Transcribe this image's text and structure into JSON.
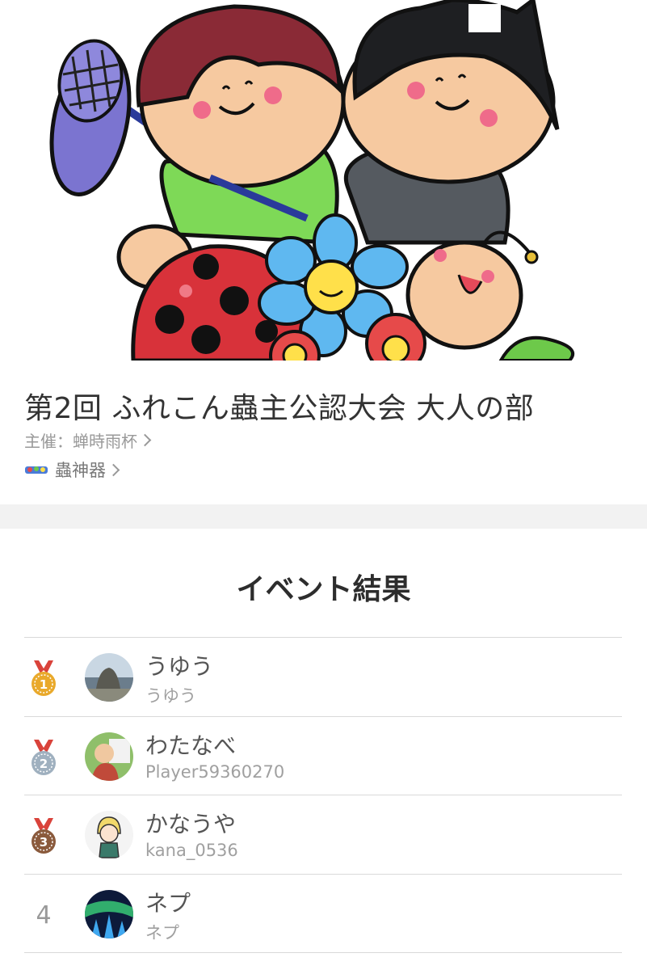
{
  "event": {
    "title": "第2回 ふれこん蟲主公認大会 大人の部",
    "organizer_label": "主催：蝉時雨杯",
    "game_label": "蟲神器"
  },
  "results": {
    "heading": "イベント結果",
    "entries": [
      {
        "rank": "1",
        "medal": "gold-medal-icon",
        "name": "うゆう",
        "id": "うゆう"
      },
      {
        "rank": "2",
        "medal": "silver-medal-icon",
        "name": "わたなべ",
        "id": "Player59360270"
      },
      {
        "rank": "3",
        "medal": "bronze-medal-icon",
        "name": "かなうや",
        "id": "kana_0536"
      },
      {
        "rank": "4",
        "medal": "",
        "name": "ネプ",
        "id": "ネプ"
      }
    ]
  },
  "colors": {
    "gold": "#e9a92b",
    "silver": "#9fb0bf",
    "bronze": "#8a5a3c",
    "ribbon": "#d9433b",
    "separator": "#f2f2f2"
  }
}
